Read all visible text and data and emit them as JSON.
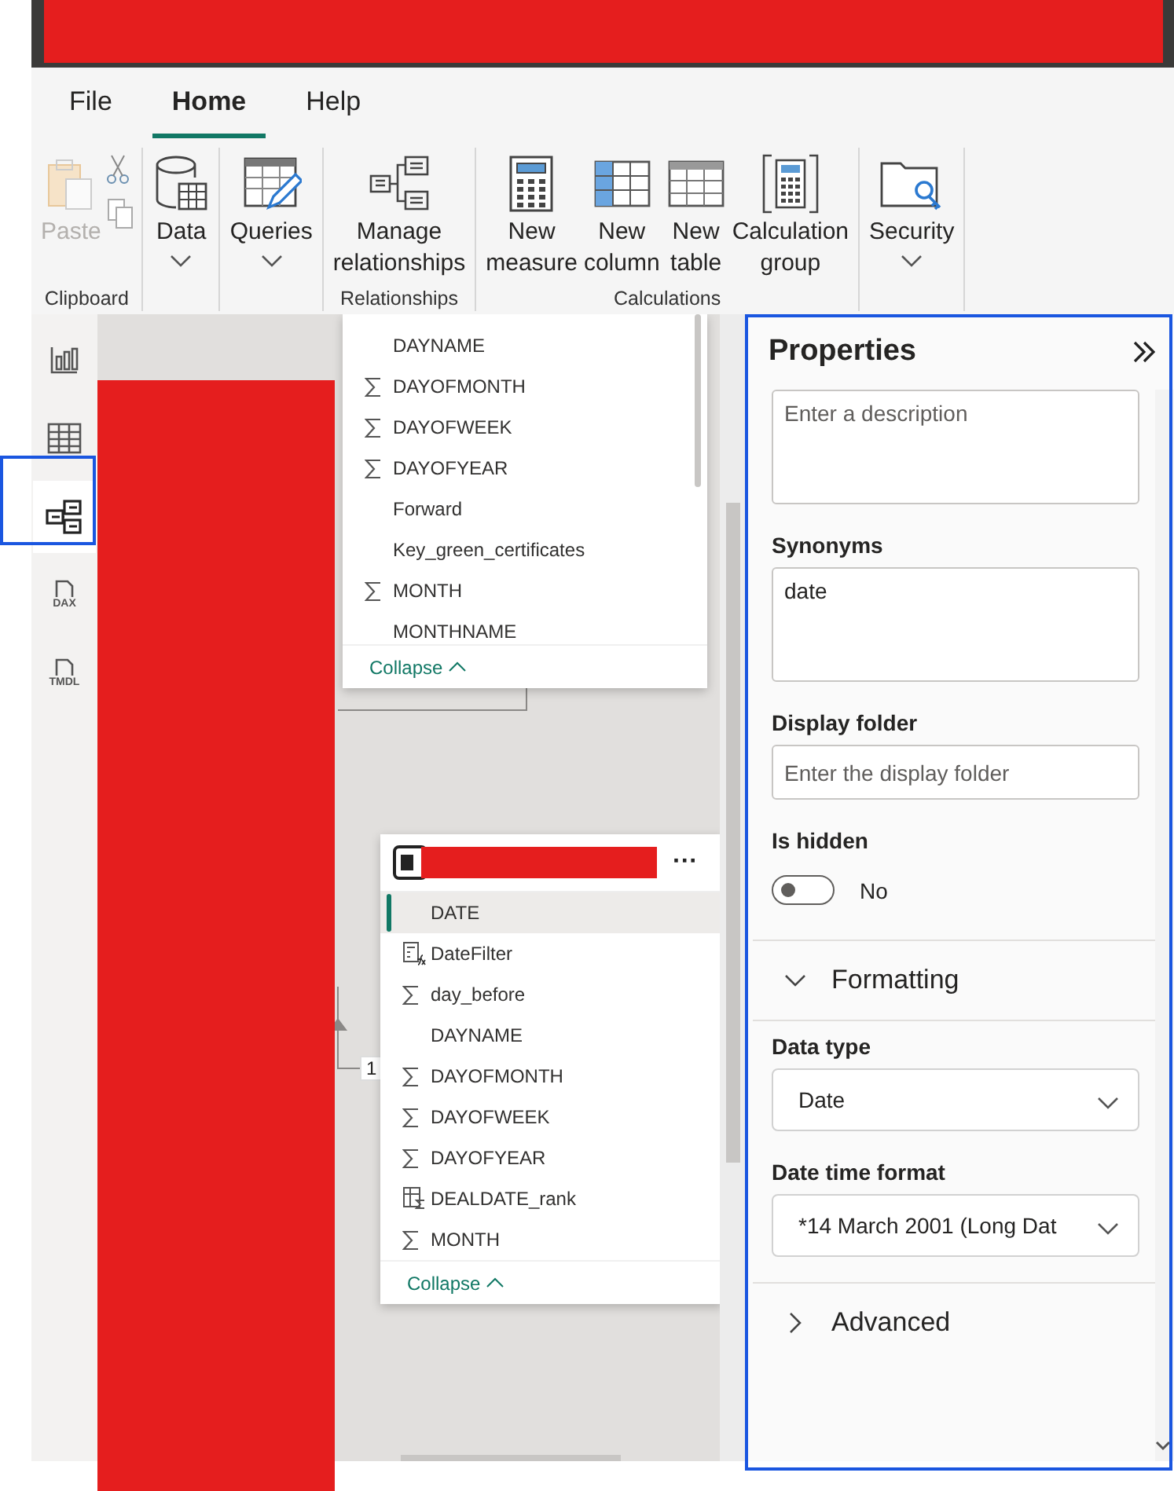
{
  "tabs": [
    {
      "label": "File",
      "selected": false
    },
    {
      "label": "Home",
      "selected": true
    },
    {
      "label": "Help",
      "selected": false
    }
  ],
  "ribbon": {
    "groups": [
      {
        "label": "Clipboard",
        "buttons": [
          {
            "label": "Paste",
            "kind": "paste",
            "disabled": true,
            "dropdown": false
          }
        ]
      },
      {
        "buttons": [
          {
            "label": "Data",
            "kind": "data",
            "disabled": false,
            "dropdown": true
          }
        ]
      },
      {
        "buttons": [
          {
            "label": "Queries",
            "kind": "queries",
            "disabled": false,
            "dropdown": true
          }
        ]
      },
      {
        "label": "Relationships",
        "buttons": [
          {
            "label": "Manage relationships",
            "kind": "relationships",
            "disabled": false,
            "dropdown": false
          }
        ]
      },
      {
        "label": "Calculations",
        "buttons": [
          {
            "label": "New measure",
            "kind": "measure",
            "disabled": false,
            "dropdown": false
          },
          {
            "label": "New column",
            "kind": "column",
            "disabled": false,
            "dropdown": false
          },
          {
            "label": "New table",
            "kind": "table",
            "disabled": false,
            "dropdown": false
          },
          {
            "label": "Calculation group",
            "kind": "calcgroup",
            "disabled": false,
            "dropdown": false
          }
        ]
      },
      {
        "buttons": [
          {
            "label": "Security",
            "kind": "security",
            "disabled": false,
            "dropdown": true
          }
        ]
      }
    ]
  },
  "rail": [
    {
      "kind": "report",
      "selected": false
    },
    {
      "kind": "grid",
      "selected": false
    },
    {
      "kind": "model",
      "selected": true
    },
    {
      "kind": "file",
      "label": "DAX",
      "selected": false
    },
    {
      "kind": "file",
      "label": "TMDL",
      "selected": false
    }
  ],
  "tables": [
    {
      "has_header": false,
      "fields": [
        {
          "name": "DAYNAME",
          "kind": "text",
          "selected": false
        },
        {
          "name": "DAYOFMONTH",
          "kind": "sum",
          "selected": false
        },
        {
          "name": "DAYOFWEEK",
          "kind": "sum",
          "selected": false
        },
        {
          "name": "DAYOFYEAR",
          "kind": "sum",
          "selected": false
        },
        {
          "name": "Forward",
          "kind": "text",
          "selected": false
        },
        {
          "name": "Key_green_certificates",
          "kind": "text",
          "selected": false
        },
        {
          "name": "MONTH",
          "kind": "sum",
          "selected": false
        },
        {
          "name": "MONTHNAME",
          "kind": "text",
          "selected": false
        }
      ],
      "collapse": "Collapse"
    },
    {
      "has_header": true,
      "menu": "···",
      "fields": [
        {
          "name": "DATE",
          "kind": "text",
          "selected": true
        },
        {
          "name": "DateFilter",
          "kind": "measure",
          "selected": false
        },
        {
          "name": "day_before",
          "kind": "sum",
          "selected": false
        },
        {
          "name": "DAYNAME",
          "kind": "text",
          "selected": false
        },
        {
          "name": "DAYOFMONTH",
          "kind": "sum",
          "selected": false
        },
        {
          "name": "DAYOFWEEK",
          "kind": "sum",
          "selected": false
        },
        {
          "name": "DAYOFYEAR",
          "kind": "sum",
          "selected": false
        },
        {
          "name": "DEALDATE_rank",
          "kind": "calc_column",
          "selected": false
        },
        {
          "name": "MONTH",
          "kind": "sum",
          "selected": false
        }
      ],
      "collapse": "Collapse"
    }
  ],
  "relationship": {
    "cardinality": "1"
  },
  "properties": {
    "title": "Properties",
    "description": {
      "placeholder": "Enter a description"
    },
    "synonyms": {
      "label": "Synonyms",
      "value": "date"
    },
    "display_folder": {
      "label": "Display folder",
      "placeholder": "Enter the display folder"
    },
    "is_hidden": {
      "label": "Is hidden",
      "on": false,
      "text": "No"
    },
    "sections": [
      {
        "title": "Formatting",
        "expanded": true,
        "fields": [
          {
            "label": "Data type",
            "value": "Date"
          },
          {
            "label": "Date time format",
            "value": "*14 March 2001 (Long Dat"
          }
        ]
      },
      {
        "title": "Advanced",
        "expanded": false
      }
    ]
  }
}
